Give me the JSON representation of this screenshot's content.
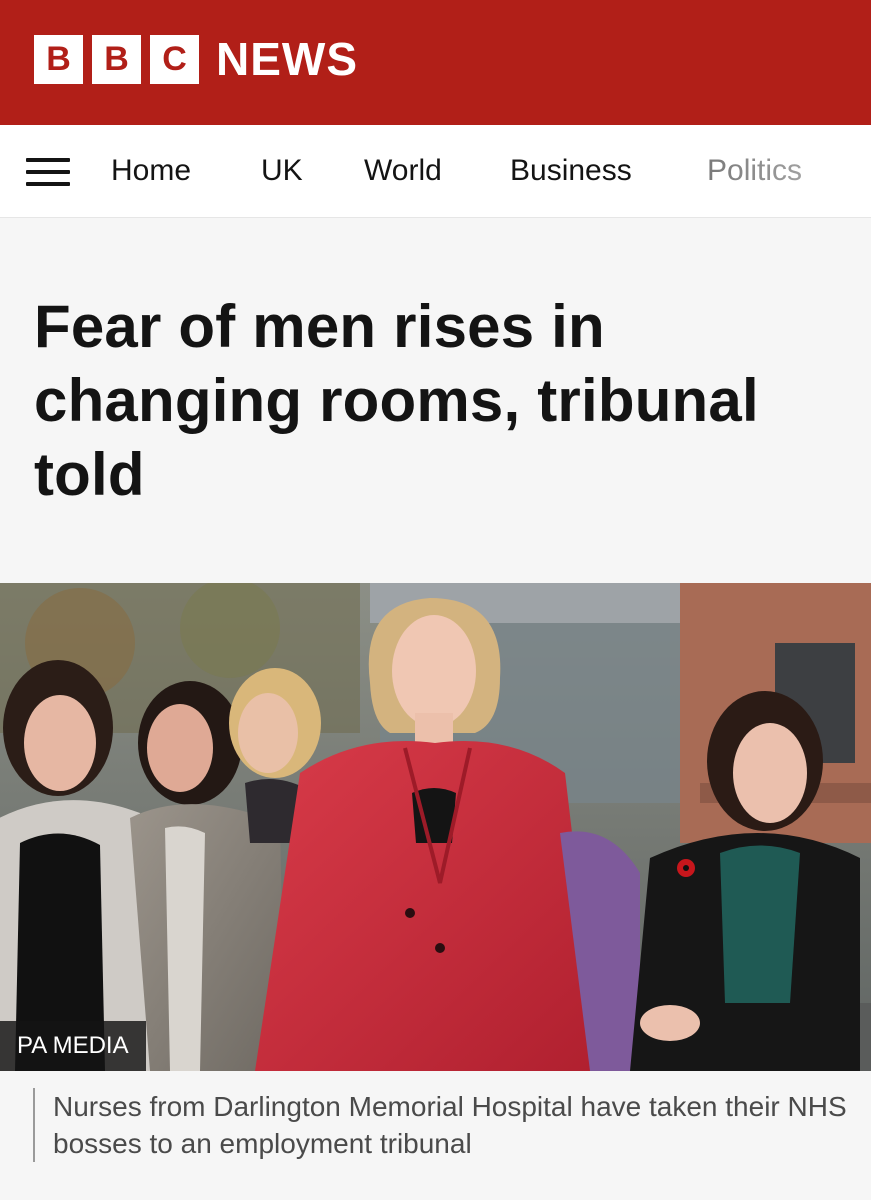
{
  "header": {
    "logo_letters": [
      "B",
      "B",
      "C"
    ],
    "logo_word": "NEWS",
    "brand_color": "#b11f18"
  },
  "nav": {
    "menu_icon": "hamburger-menu-icon",
    "items": [
      "Home",
      "UK",
      "World",
      "Business",
      "Politics"
    ]
  },
  "article": {
    "headline": "Fear of men rises in changing rooms, tribunal told",
    "image_credit": "PA MEDIA",
    "image_caption": "Nurses from Darlington Memorial Hospital have taken their NHS bosses to an employment tribunal"
  }
}
